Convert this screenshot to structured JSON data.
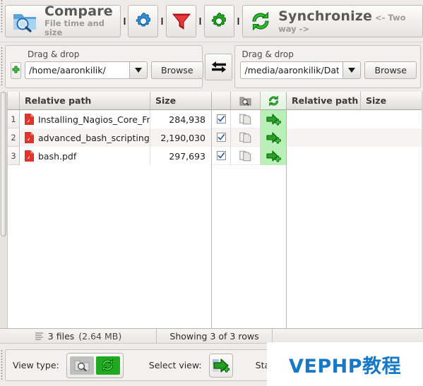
{
  "app": {
    "accent_green": "#1faa1f",
    "action_cell_bg": "#b8f0b8",
    "watermark_color": "#1878c8"
  },
  "toolbar": {
    "compare": {
      "title": "Compare",
      "subtitle": "File time and size",
      "icon": "folder-search-icon"
    },
    "compare_settings": {
      "label": "",
      "icon": "blue-gear-icon"
    },
    "filter": {
      "label": "",
      "icon": "red-funnel-icon"
    },
    "sync_settings": {
      "label": "",
      "icon": "green-gear-icon"
    },
    "synchronize": {
      "title": "Synchronize",
      "subtitle": "<- Two way ->",
      "icon": "green-sync-icon"
    },
    "dropdown_marker": "▾"
  },
  "paths": {
    "left": {
      "drag_drop_label": "Drag & drop",
      "value": "/home/aaronkilik/",
      "placeholder": "",
      "browse_label": "Browse",
      "add_icon": "green-plus-icon",
      "dropdown_icon": "chevron-down-icon"
    },
    "right": {
      "drag_drop_label": "Drag & drop",
      "value": "/media/aaronkilik/Dat",
      "placeholder": "",
      "browse_label": "Browse",
      "dropdown_icon": "chevron-down-icon"
    },
    "swap": {
      "icon": "swap-arrows-icon"
    }
  },
  "grid": {
    "left": {
      "columns": [
        "Relative path",
        "Size"
      ],
      "rows": [
        {
          "num": "1",
          "icon": "pdf-file-icon",
          "path": "Installing_Nagios_Core_Fro...",
          "size": "284,938"
        },
        {
          "num": "2",
          "icon": "pdf-file-icon",
          "path": "advanced_bash_scripting.pdf",
          "size": "2,190,030"
        },
        {
          "num": "3",
          "icon": "pdf-file-icon",
          "path": "bash.pdf",
          "size": "297,693"
        }
      ]
    },
    "middle": {
      "header_icons": [
        "",
        "category-icon",
        "sync-action-icon"
      ],
      "rows": [
        {
          "checked": true,
          "category_icon": "file-copy-icon",
          "action_icon": "copy-right-icon"
        },
        {
          "checked": true,
          "category_icon": "file-copy-icon",
          "action_icon": "copy-right-icon"
        },
        {
          "checked": true,
          "category_icon": "file-copy-icon",
          "action_icon": "copy-right-icon"
        }
      ]
    },
    "right": {
      "columns": [
        "Relative path",
        "Size"
      ],
      "rows": [
        {
          "path": "",
          "size": ""
        },
        {
          "path": "",
          "size": ""
        },
        {
          "path": "",
          "size": ""
        }
      ]
    }
  },
  "statusbar": {
    "files_icon": "list-icon",
    "files_text": "3 files",
    "files_size": "(2.64 MB)",
    "rows_text": "Showing 3 of 3 rows",
    "rest_text": ""
  },
  "bottombar": {
    "view_type_label": "View type:",
    "view_type_off_icon": "folder-search-icon",
    "view_type_on_icon": "green-sync-icon",
    "select_view_label": "Select view:",
    "select_view_icon": "copy-right-icon",
    "statistics_label": "Stati"
  },
  "watermark": {
    "text": "VEPHP教程"
  }
}
